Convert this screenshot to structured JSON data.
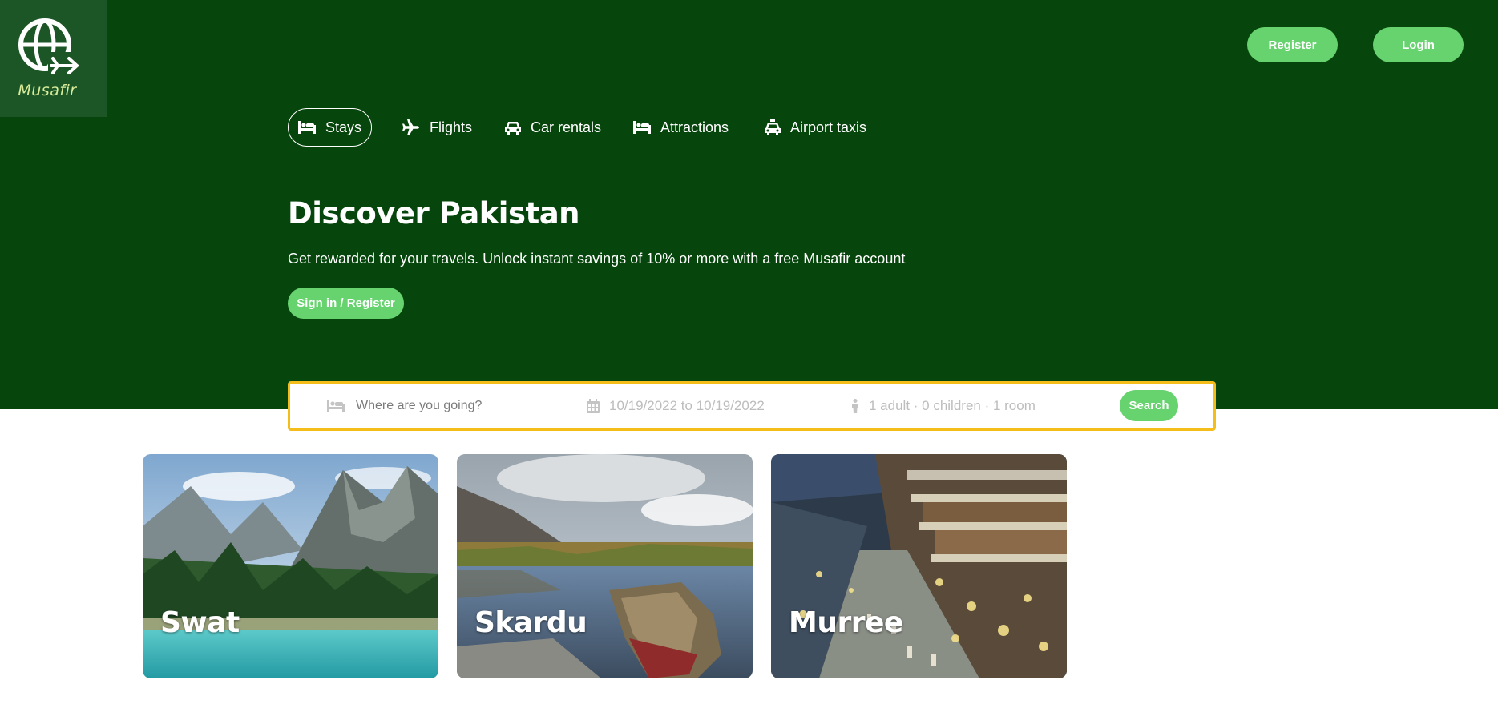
{
  "brand": {
    "logo_text": "Musafir"
  },
  "header": {
    "register_label": "Register",
    "login_label": "Login"
  },
  "nav": {
    "items": [
      {
        "label": "Stays",
        "icon": "bed-icon",
        "active": true
      },
      {
        "label": "Flights",
        "icon": "plane-icon",
        "active": false
      },
      {
        "label": "Car rentals",
        "icon": "car-icon",
        "active": false
      },
      {
        "label": "Attractions",
        "icon": "bed-icon",
        "active": false
      },
      {
        "label": "Airport taxis",
        "icon": "taxi-icon",
        "active": false
      }
    ]
  },
  "hero": {
    "title": "Discover Pakistan",
    "subtitle": "Get rewarded for your travels. Unlock instant savings of 10% or more with a free Musafir account",
    "cta_label": "Sign in / Register"
  },
  "search": {
    "destination_placeholder": "Where are you going?",
    "date_range": "10/19/2022 to 10/19/2022",
    "guests": "1 adult · 0 children · 1 room",
    "button_label": "Search"
  },
  "destinations": [
    {
      "name": "Swat"
    },
    {
      "name": "Skardu"
    },
    {
      "name": "Murree"
    }
  ],
  "colors": {
    "hero_bg": "#06450c",
    "logo_bg": "#1c5626",
    "accent_green": "#66d36e",
    "search_border": "#f4bd1a"
  }
}
